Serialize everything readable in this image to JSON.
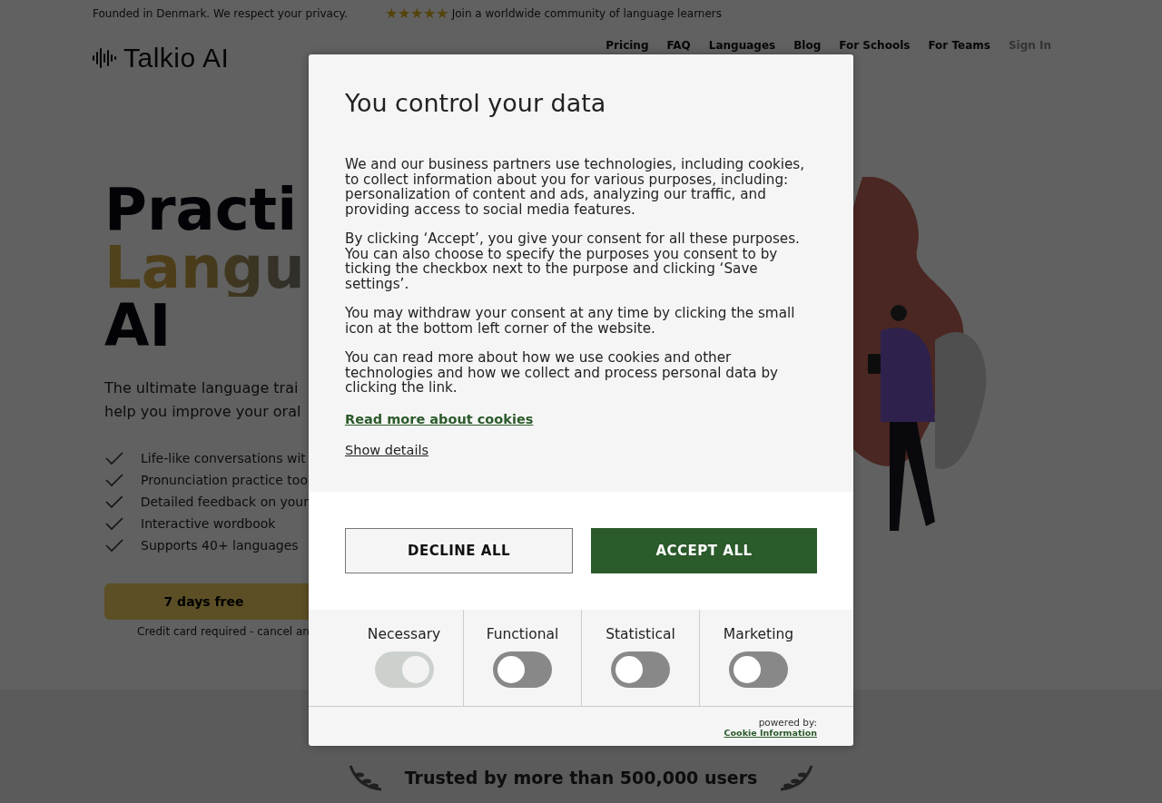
{
  "top_bar": {
    "note": "Founded in Denmark. We respect your privacy.",
    "stars": 5,
    "community": "Join a worldwide community of language learners"
  },
  "header": {
    "logo": "Talkio AI",
    "nav": [
      {
        "label": "Pricing",
        "kind": "link"
      },
      {
        "label": "FAQ",
        "kind": "link"
      },
      {
        "label": "Languages",
        "kind": "link"
      },
      {
        "label": "Blog",
        "kind": "link"
      },
      {
        "label": "For Schools",
        "kind": "link"
      },
      {
        "label": "For Teams",
        "kind": "link"
      },
      {
        "label": "Sign In",
        "kind": "muted"
      }
    ]
  },
  "hero": {
    "title_lines": [
      {
        "text": "Practi",
        "kind": "plain"
      },
      {
        "text": "Langu",
        "kind": "accent"
      },
      {
        "text": "AI",
        "kind": "plain"
      }
    ],
    "subtitle_lines": [
      "The ultimate language trai",
      "help you improve your oral"
    ],
    "features": [
      "Life-like conversations wit",
      "Pronunciation practice too",
      "Detailed feedback on your",
      "Interactive wordbook",
      "Supports 40+ languages"
    ],
    "cta": "7 days free",
    "cta_note": "Credit card required - cancel an"
  },
  "trust": {
    "text": "Trusted by more than 500,000 users"
  },
  "consent_dialog": {
    "title": "You control your data",
    "paragraphs": [
      "We and our business partners use technologies, including cookies, to collect information about you for various purposes, including: personalization of content and ads, analyzing our traffic, and providing access to social media features.",
      "By clicking ‘Accept’, you give your consent for all these purposes. You can also choose to specify the purposes you consent to by ticking the checkbox next to the purpose and clicking ‘Save settings’.",
      "You may withdraw your consent at any time by clicking the small icon at the bottom left corner of the website.",
      "You can read more about how we use cookies and other technologies and how we collect and process personal data by clicking the link."
    ],
    "read_more_link": "Read more about cookies",
    "details_link": "Show details",
    "buttons": [
      {
        "label": "DECLINE ALL",
        "kind": "secondary"
      },
      {
        "label": "ACCEPT ALL",
        "kind": "primary"
      }
    ],
    "categories": [
      {
        "label": "Necessary",
        "checked": true,
        "disabled": true
      },
      {
        "label": "Functional",
        "checked": false,
        "disabled": false
      },
      {
        "label": "Statistical",
        "checked": false,
        "disabled": false
      },
      {
        "label": "Marketing",
        "checked": false,
        "disabled": false
      }
    ],
    "powered_by": "powered by:",
    "provider_link": "Cookie Information"
  }
}
